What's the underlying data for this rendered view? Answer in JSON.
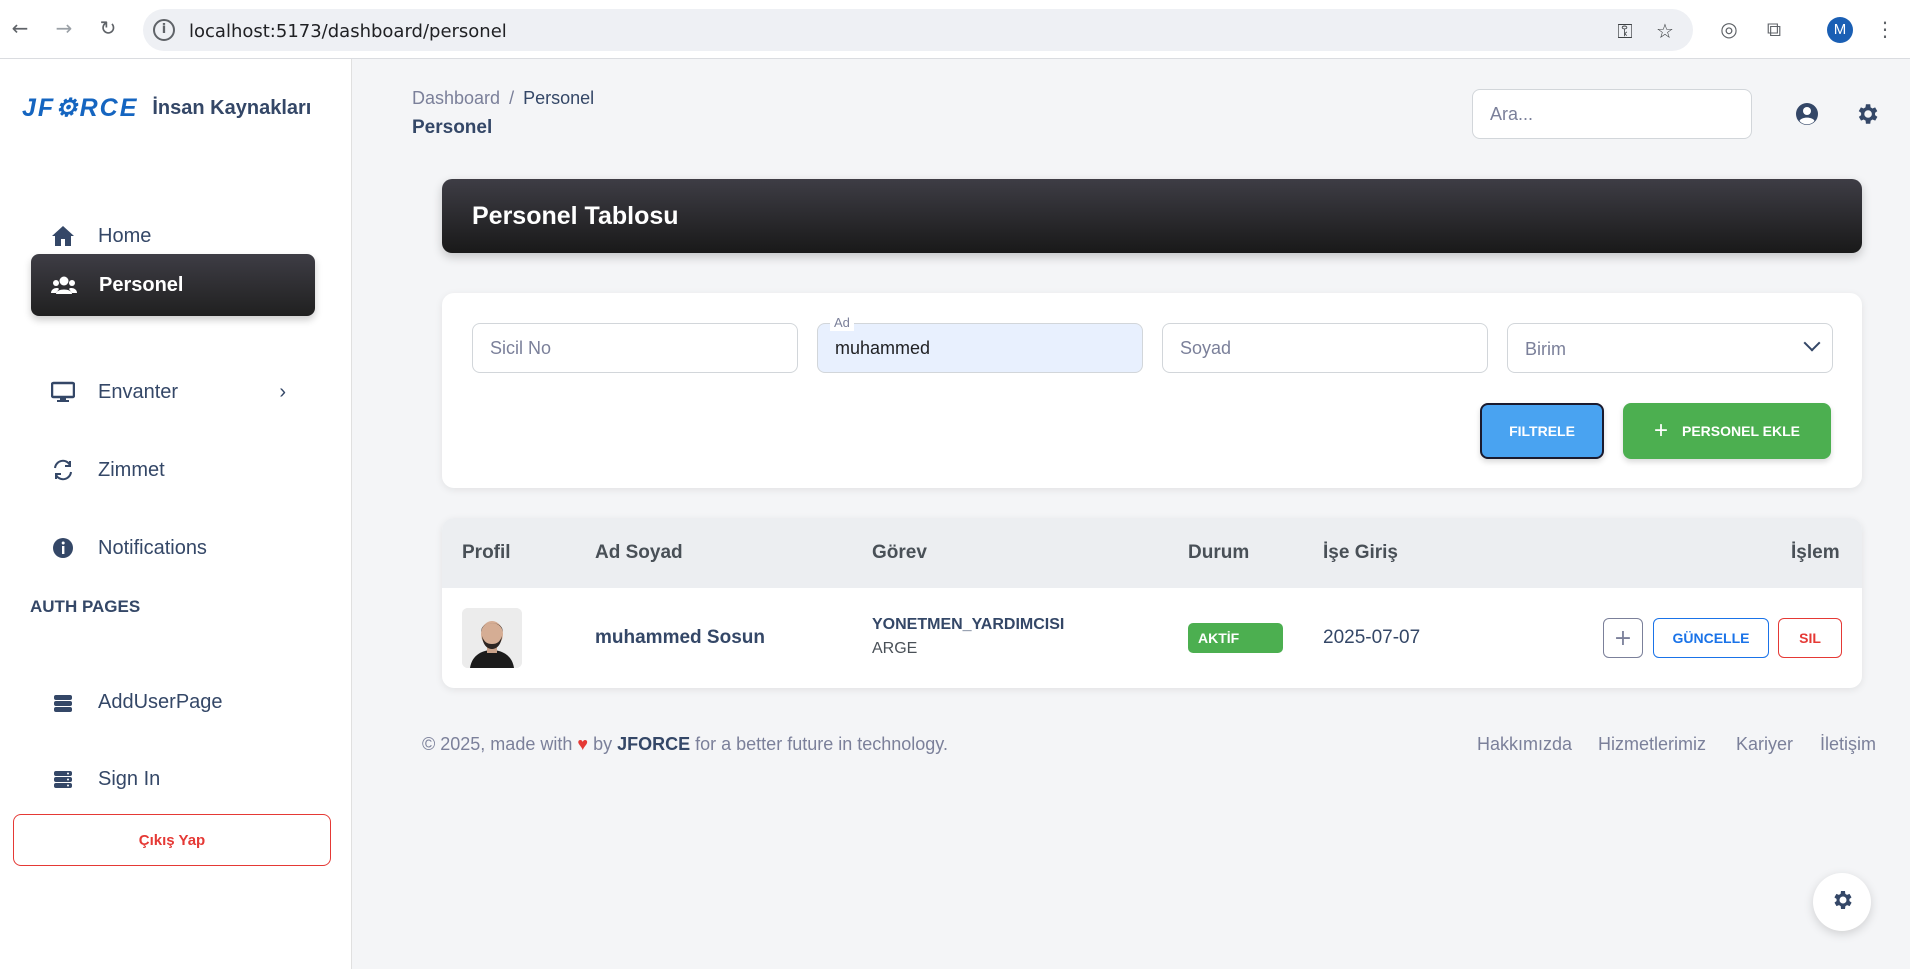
{
  "browser": {
    "url": "localhost:5173/dashboard/personel",
    "profile_initial": "M"
  },
  "sidebar": {
    "logo": "JF⚙RCE",
    "app_name": "İnsan Kaynakları",
    "items": [
      {
        "label": "Home"
      },
      {
        "label": "Personel"
      },
      {
        "label": "Envanter"
      },
      {
        "label": "Zimmet"
      },
      {
        "label": "Notifications"
      }
    ],
    "section_label": "AUTH PAGES",
    "auth_items": [
      {
        "label": "AddUserPage"
      },
      {
        "label": "Sign In"
      }
    ],
    "logout_label": "Çıkış Yap"
  },
  "header": {
    "breadcrumb_root": "Dashboard",
    "breadcrumb_separator": "/",
    "breadcrumb_current": "Personel",
    "page_title": "Personel",
    "search_placeholder": "Ara..."
  },
  "title_card": {
    "title": "Personel Tablosu"
  },
  "filters": {
    "sicil_placeholder": "Sicil No",
    "ad_label": "Ad",
    "ad_value": "muhammed",
    "soyad_placeholder": "Soyad",
    "birim_placeholder": "Birim",
    "filter_button": "FILTRELE",
    "add_button": "PERSONEL EKLE"
  },
  "table": {
    "headers": [
      "Profil",
      "Ad Soyad",
      "Görev",
      "Durum",
      "İşe Giriş",
      "İşlem"
    ],
    "rows": [
      {
        "name": "muhammed Sosun",
        "role": "YONETMEN_YARDIMCISI",
        "department": "ARGE",
        "status": "AKTİF",
        "start_date": "2025-07-07",
        "update_label": "GÜNCELLE",
        "delete_label": "SIL"
      }
    ]
  },
  "footer": {
    "prefix": "© 2025, made with",
    "by": "by",
    "brand": "JFORCE",
    "suffix": "for a better future in technology.",
    "links": [
      "Hakkımızda",
      "Hizmetlerimiz",
      "Kariyer",
      "İletişim"
    ]
  },
  "colors": {
    "accent_blue": "#49a3f1",
    "success_green": "#4caf50",
    "danger_red": "#e53935",
    "dark": "#202020"
  }
}
